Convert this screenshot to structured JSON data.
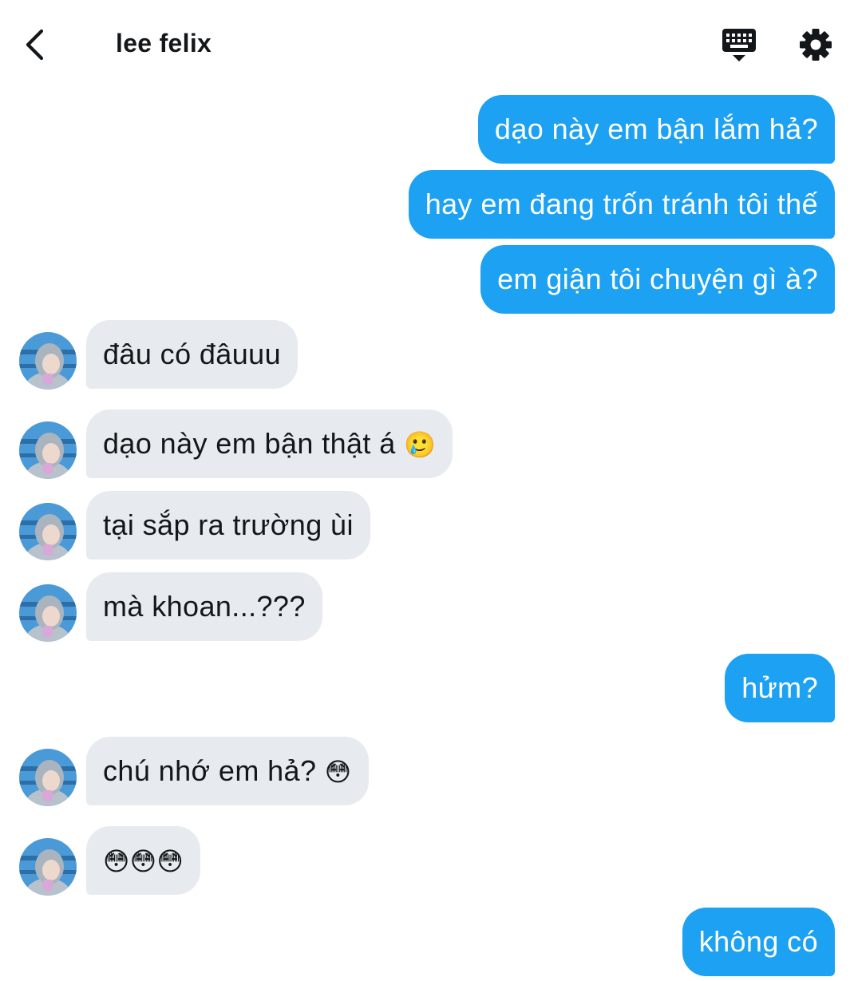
{
  "header": {
    "contact_name": "lee felix",
    "icons": {
      "back": "chevron-left-icon",
      "keyboard": "keyboard-icon",
      "settings": "gear-icon"
    }
  },
  "colors": {
    "outgoing": "#1da1f2",
    "incoming": "#e7ebef",
    "text": "#14171a"
  },
  "messages": [
    {
      "from": "me",
      "text": "dạo này em bận lắm hả?"
    },
    {
      "from": "me",
      "text": "hay em đang trốn tránh tôi thế"
    },
    {
      "from": "me",
      "text": "em giận tôi chuyện gì à?"
    },
    {
      "from": "them",
      "text": "đâu có đâuuu"
    },
    {
      "from": "them",
      "text": "dạo này em bận thật á",
      "emoji": "🥲"
    },
    {
      "from": "them",
      "text": "tại sắp ra trường ùi"
    },
    {
      "from": "them",
      "text": "mà khoan...???"
    },
    {
      "from": "me",
      "text": "hửm?"
    },
    {
      "from": "them",
      "text": "chú nhớ em hả?",
      "emoji": "😳"
    },
    {
      "from": "them",
      "text": "",
      "emoji": "😳😳😳"
    },
    {
      "from": "me",
      "text": "không có"
    }
  ]
}
